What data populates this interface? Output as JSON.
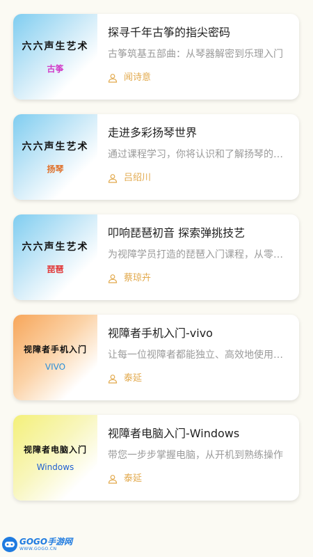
{
  "courses": [
    {
      "thumb_line1": "六六声生艺术",
      "thumb_line2": "古筝",
      "thumb_bg": "linear-gradient(135deg, #7fcdf0 0%, #cdeaf8 45%, #ffffff 75%)",
      "thumb_color2": "#d23cc8",
      "title": "探寻千年古筝的指尖密码",
      "desc": "古筝筑基五部曲：从琴器解密到乐理入门",
      "author": "闻诗意"
    },
    {
      "thumb_line1": "六六声生艺术",
      "thumb_line2": "扬琴",
      "thumb_bg": "linear-gradient(135deg, #7fcdf0 0%, #cdeaf8 45%, #ffffff 75%)",
      "thumb_color2": "#e0702a",
      "title": "走进多彩扬琴世界",
      "desc": "通过课程学习，你将认识和了解扬琴的魅力",
      "author": "吕绍川"
    },
    {
      "thumb_line1": "六六声生艺术",
      "thumb_line2": "琵琶",
      "thumb_bg": "linear-gradient(135deg, #7fcdf0 0%, #cdeaf8 45%, #ffffff 75%)",
      "thumb_color2": "#e23a3a",
      "title": "叩响琵琶初音 探索弹挑技艺",
      "desc": "为视障学员打造的琵琶入门课程，从零开始",
      "author": "蔡琼卉"
    },
    {
      "thumb_line1": "视障者手机入门",
      "thumb_line2": "VIVO",
      "thumb_bg": "linear-gradient(135deg, #f7a65a 0%, #fbd3a8 45%, #ffffff 80%)",
      "thumb_color2": "#2a8fd8",
      "title": "视障者手机入门-vivo",
      "desc": "让每一位视障者都能独立、高效地使用手机",
      "author": "泰延"
    },
    {
      "thumb_line1": "视障者电脑入门",
      "thumb_line2": "Windows",
      "thumb_bg": "linear-gradient(135deg, #f4f07a 0%, #f8f6bc 45%, #ffffff 80%)",
      "thumb_color2": "#1f5fd0",
      "title": "视障者电脑入门-Windows",
      "desc": "带您一步步掌握电脑，从开机到熟练操作",
      "author": "泰延"
    }
  ],
  "watermark": {
    "name": "GOGO手游网",
    "url": "WWW.GOGO.CN"
  },
  "colors": {
    "page_bg": "#fbfaf3",
    "author": "#e2a94c",
    "desc": "#9a9a9a"
  }
}
